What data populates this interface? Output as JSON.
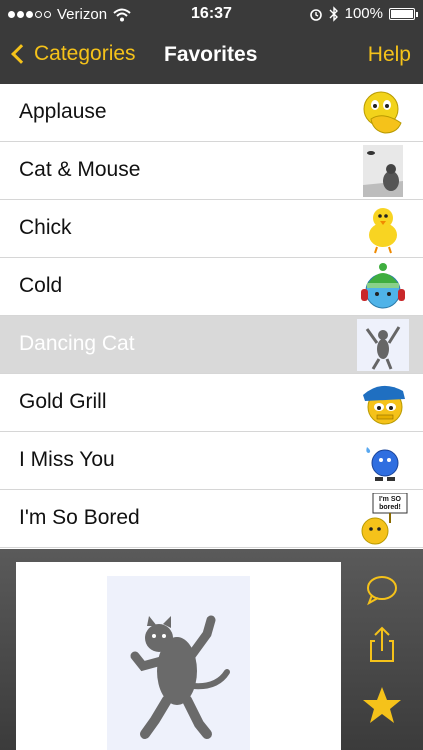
{
  "status": {
    "carrier": "Verizon",
    "time": "16:37",
    "battery": "100%",
    "signal_bars_filled": 3,
    "signal_bars_total": 5
  },
  "nav": {
    "back_label": "Categories",
    "title": "Favorites",
    "help_label": "Help"
  },
  "list": {
    "items": [
      {
        "label": "Applause",
        "icon": "applause-emoticon-icon"
      },
      {
        "label": "Cat & Mouse",
        "icon": "cat-mouse-photo-icon"
      },
      {
        "label": "Chick",
        "icon": "chick-icon"
      },
      {
        "label": "Cold",
        "icon": "cold-emoticon-icon"
      },
      {
        "label": "Dancing Cat",
        "icon": "dancing-cat-icon",
        "selected": true
      },
      {
        "label": "Gold Grill",
        "icon": "gold-grill-emoticon-icon"
      },
      {
        "label": "I Miss You",
        "icon": "crying-emoticon-icon"
      },
      {
        "label": "I'm So Bored",
        "icon": "bored-sign-emoticon-icon",
        "sign_text": "I'm SO bored!"
      }
    ]
  },
  "preview": {
    "icon": "dancing-cat-preview-icon"
  },
  "actions": [
    {
      "name": "comment-button",
      "icon": "speech-bubble-icon"
    },
    {
      "name": "share-button",
      "icon": "share-icon"
    },
    {
      "name": "favorite-button",
      "icon": "star-icon"
    }
  ],
  "colors": {
    "accent": "#f5c21a",
    "bar": "#3a3a3a",
    "selected_row": "#d9d9d9"
  }
}
